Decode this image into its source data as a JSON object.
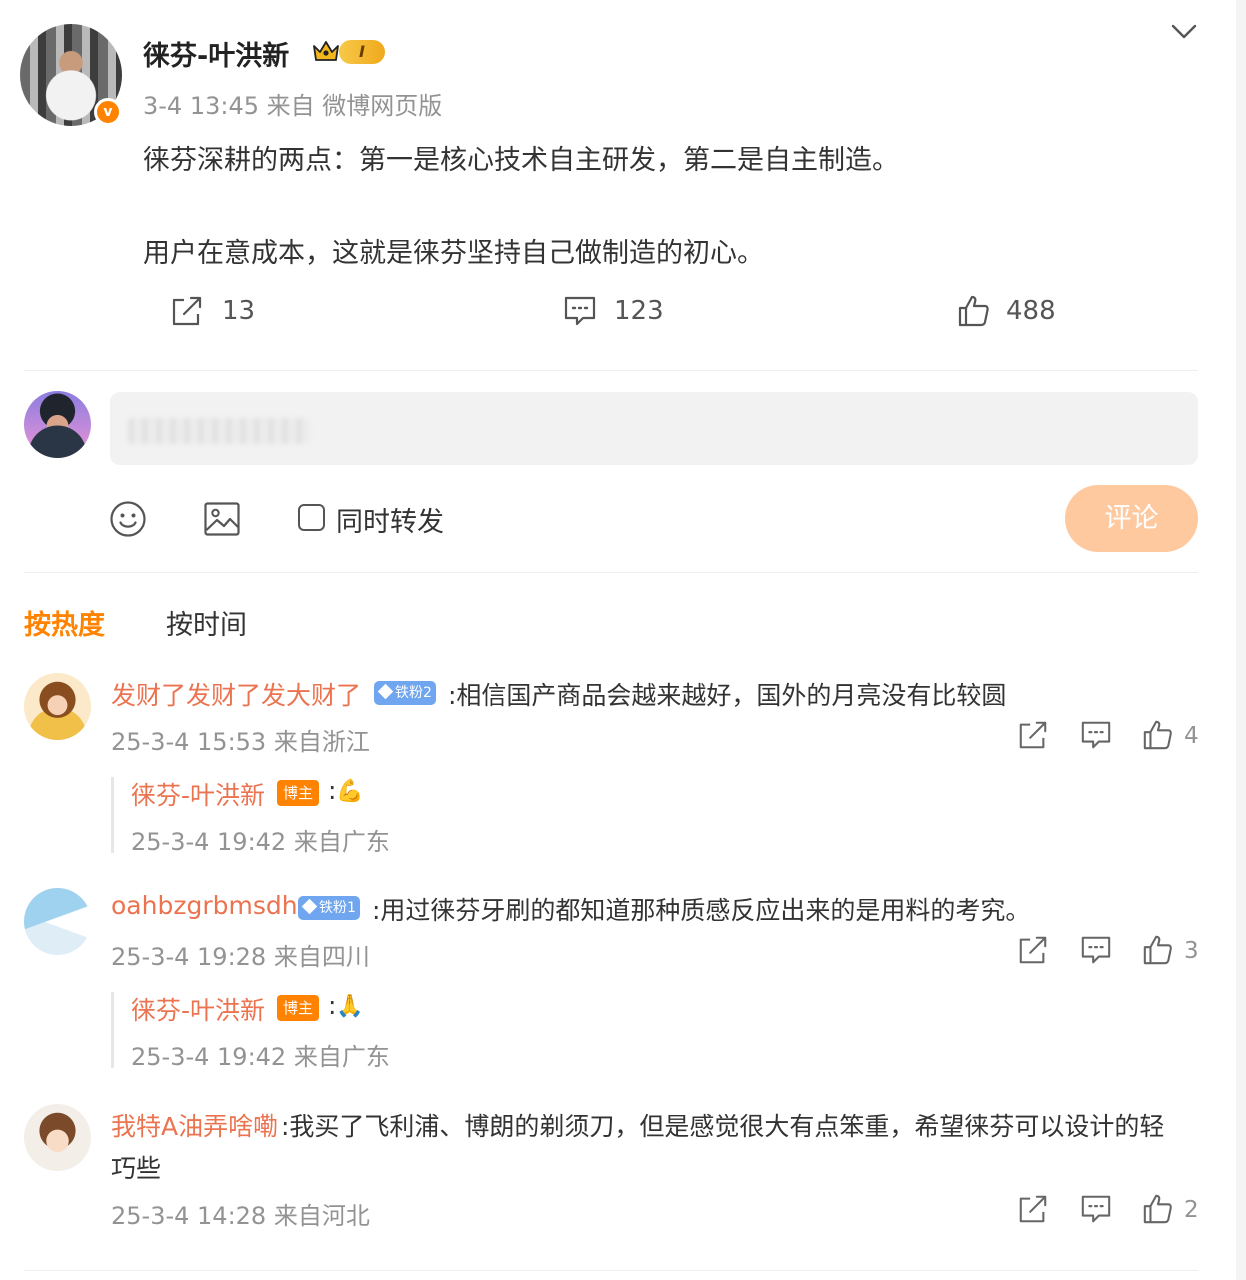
{
  "post": {
    "author_name": "徕芬-叶洪新",
    "level_label": "I",
    "verified_mark": "v",
    "meta": "3-4 13:45 来自 微博网页版",
    "paragraphs": [
      "徕芬深耕的两点：第一是核心技术自主研发，第二是自主制造。",
      "用户在意成本，这就是徕芬坚持自己做制造的初心。"
    ],
    "actions": {
      "repost_count": "13",
      "comment_count": "123",
      "like_count": "488"
    }
  },
  "composer": {
    "placeholder": "",
    "repost_label": "同时转发",
    "submit_label": "评论"
  },
  "sort": {
    "hot_label": "按热度",
    "time_label": "按时间"
  },
  "comments": [
    {
      "name": "发财了发财了发大财了",
      "fan_badge": "铁粉2",
      "text": ":相信国产商品会越来越好，国外的月亮没有比较圆",
      "meta": "25-3-4 15:53 来自浙江",
      "likes": "4",
      "reply": {
        "name": "徕芬-叶洪新",
        "badge": "博主",
        "colon": ":",
        "emoji": "💪",
        "meta": "25-3-4 19:42 来自广东"
      }
    },
    {
      "name": "oahbzgrbmsdh",
      "fan_badge": "铁粉1",
      "text": ":用过徕芬牙刷的都知道那种质感反应出来的是用料的考究。",
      "meta": "25-3-4 19:28 来自四川",
      "likes": "3",
      "reply": {
        "name": "徕芬-叶洪新",
        "badge": "博主",
        "colon": ":",
        "emoji": "🙏",
        "meta": "25-3-4 19:42 来自广东"
      }
    },
    {
      "name": "我特A油弄啥嘞",
      "text_line1": ":我买了飞利浦、博朗的剃须刀，但是感觉很大有点笨重，希望徕芬可以设计的轻",
      "text_line2": "巧些",
      "meta": "25-3-4 14:28 来自河北",
      "likes": "2"
    }
  ],
  "colors": {
    "accent": "#ff8200",
    "name_link": "#eb7350",
    "fan_badge": "#6fa6ef",
    "submit_disabled": "#ffc9a0",
    "meta_gray": "#939393"
  },
  "icons": [
    "crown-icon",
    "chevron-down-icon",
    "repost-icon",
    "comment-icon",
    "like-icon",
    "emoji-icon",
    "image-icon"
  ]
}
